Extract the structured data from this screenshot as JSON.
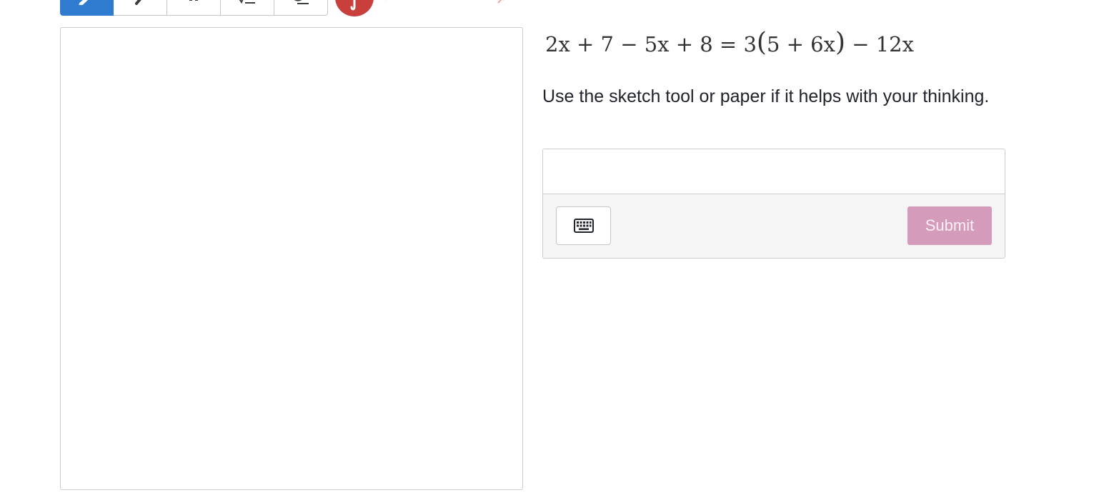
{
  "toolbar": {
    "tools": [
      {
        "name": "pen-icon",
        "active": true
      },
      {
        "name": "highlighter-icon",
        "active": false
      },
      {
        "name": "text-tool-icon",
        "active": false
      },
      {
        "name": "math-tool-icon",
        "active": false
      },
      {
        "name": "eraser-icon",
        "active": false
      }
    ],
    "pen_color": "#c93f3c",
    "active_color": "#2e7bcf"
  },
  "question": {
    "equation": {
      "lhs": "2x + 7 − 5x + 8 = 3",
      "open_paren": "(",
      "inner": "5 + 6x",
      "close_paren": ")",
      "rhs": " − 12x"
    },
    "instructions": "Use the sketch tool or paper if it helps with your thinking."
  },
  "answer": {
    "value": "",
    "placeholder": "",
    "keyboard_icon": "keyboard-icon",
    "submit_label": "Submit",
    "submit_color": "#d49bbb"
  }
}
